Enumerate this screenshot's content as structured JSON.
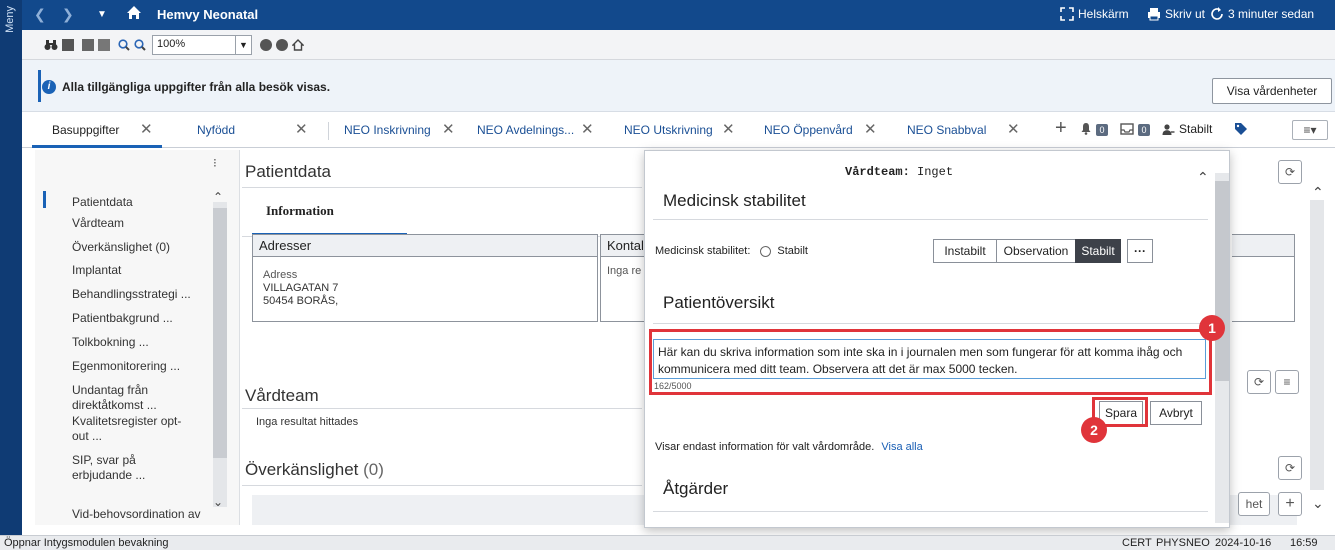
{
  "app": {
    "menu_label": "Meny",
    "title": "Hemvy Neonatal",
    "fullscreen_label": "Helskärm",
    "print_label": "Skriv ut",
    "refresh_label": "3 minuter sedan"
  },
  "toolbar": {
    "zoom": "100%"
  },
  "banner": {
    "text": "Alla tillgängliga uppgifter från alla besök visas.",
    "button": "Visa vårdenheter"
  },
  "tabs": [
    {
      "label": "Basuppgifter"
    },
    {
      "label": "Nyfödd"
    },
    {
      "label": "NEO Inskrivning"
    },
    {
      "label": "NEO Avdelnings..."
    },
    {
      "label": "NEO Utskrivning"
    },
    {
      "label": "NEO Öppenvård"
    },
    {
      "label": "NEO Snabbval"
    }
  ],
  "tab_tools": {
    "bell_count": "0",
    "inbox_count": "0",
    "stability": "Stabilt"
  },
  "sidebar": {
    "items": [
      "Patientdata",
      "Vårdteam",
      "Överkänslighet (0)",
      "Implantat",
      "Behandlingsstrategi ...",
      "Patientbakgrund ...",
      "Tolkbokning ...",
      "Egenmonitorering ...",
      "Undantag från direktåtkomst ...",
      "Kvalitetsregister opt-out ...",
      "SIP, svar på erbjudande ...",
      "Vid-behovsordination av"
    ]
  },
  "main": {
    "patientdata_title": "Patientdata",
    "info_tab": "Information",
    "addresses_header": "Adresser",
    "address_label": "Adress",
    "address_line1": "VILLAGATAN 7",
    "address_line2": "50454 BORÅS,",
    "contact_header": "Kontal",
    "contact_text": "Inga re",
    "vardteam_title": "Vårdteam",
    "vardteam_empty": "Inga resultat hittades",
    "overkanslighet_title": "Överkänslighet",
    "overkanslighet_count": "(0)",
    "bottom_btn": "het"
  },
  "popup": {
    "team_label": "Vårdteam:",
    "team_value": "Inget",
    "stability_title": "Medicinsk stabilitet",
    "stability_label": "Medicinsk stabilitet:",
    "stability_radio": "Stabilt",
    "seg_unstable": "Instabilt",
    "seg_observation": "Observation",
    "seg_stable": "Stabilt",
    "seg_more": "···",
    "overview_title": "Patientöversikt",
    "overview_text": "Här kan du skriva information som inte ska in i journalen men som fungerar för att komma ihåg och kommunicera med ditt team. Observera att det är max 5000 tecken.",
    "char_count": "162/5000",
    "save": "Spara",
    "cancel": "Avbryt",
    "filter_text": "Visar endast information för valt vårdområde.",
    "show_all": "Visa alla",
    "actions_title": "Åtgärder",
    "callout1": "1",
    "callout2": "2"
  },
  "status": {
    "left": "Öppnar Intygsmodulen bevakning",
    "env": "CERT",
    "user": "PHYSNEO",
    "date": "2024-10-16",
    "time": "16:59"
  }
}
